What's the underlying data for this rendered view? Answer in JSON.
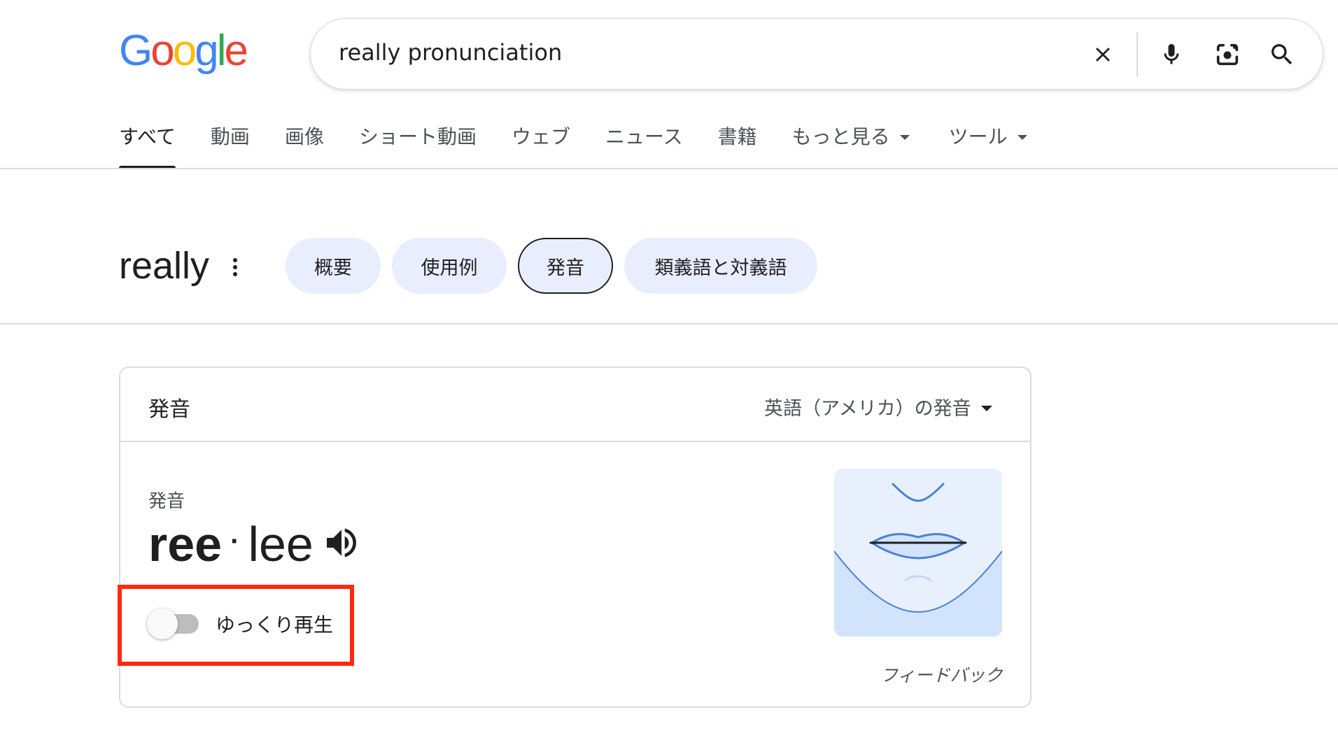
{
  "logo": {
    "letters": [
      {
        "char": "G",
        "color": "#4285F4"
      },
      {
        "char": "o",
        "color": "#EA4335"
      },
      {
        "char": "o",
        "color": "#FBBC05"
      },
      {
        "char": "g",
        "color": "#4285F4"
      },
      {
        "char": "l",
        "color": "#34A853"
      },
      {
        "char": "e",
        "color": "#EA4335"
      }
    ]
  },
  "search": {
    "query": "really pronunciation",
    "icons": [
      "close-icon",
      "microphone-icon",
      "camera-lens-icon",
      "search-icon"
    ]
  },
  "tabs": [
    {
      "label": "すべて",
      "active": true
    },
    {
      "label": "動画"
    },
    {
      "label": "画像"
    },
    {
      "label": "ショート動画"
    },
    {
      "label": "ウェブ"
    },
    {
      "label": "ニュース"
    },
    {
      "label": "書籍"
    },
    {
      "label": "もっと見る",
      "dropdown": true
    },
    {
      "label": "ツール",
      "dropdown": true
    }
  ],
  "word": {
    "title": "really",
    "chips": [
      "概要",
      "使用例",
      "発音",
      "類義語と対義語"
    ],
    "selected_chip": "発音"
  },
  "card": {
    "title": "発音",
    "dialect": "英語（アメリカ）の発音",
    "pronunciation_label": "発音",
    "syllables": [
      {
        "text": "ree",
        "stressed": true
      },
      {
        "text": "lee",
        "stressed": false
      }
    ],
    "syllable_separator": "·",
    "slow_playback_label": "ゆっくり再生",
    "slow_playback_on": false,
    "feedback_label": "フィードバック"
  },
  "colors": {
    "chip_bg": "#e8eefd",
    "highlight": "#ff2a0e",
    "text_secondary": "#4d5156"
  }
}
